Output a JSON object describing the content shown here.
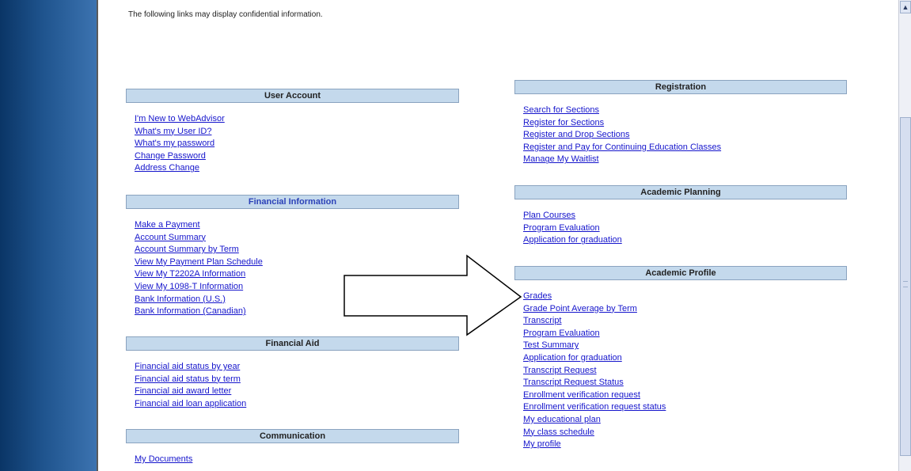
{
  "notice": "The following links may display confidential information.",
  "sections": {
    "user_account": {
      "title": "User Account",
      "links": [
        "I'm New to WebAdvisor",
        "What's my User ID?",
        "What's my password",
        "Change Password",
        "Address Change"
      ]
    },
    "financial_information": {
      "title": "Financial Information",
      "links": [
        "Make a Payment",
        "Account Summary",
        "Account Summary by Term",
        "View My Payment Plan Schedule",
        "View My T2202A Information",
        "View My 1098-T Information",
        "Bank Information (U.S.)",
        "Bank Information (Canadian)"
      ]
    },
    "financial_aid": {
      "title": "Financial Aid",
      "links": [
        "Financial aid status by year",
        "Financial aid status by term",
        "Financial aid award letter",
        "Financial aid loan application"
      ]
    },
    "communication": {
      "title": "Communication",
      "links": [
        "My Documents"
      ]
    },
    "registration": {
      "title": "Registration",
      "links": [
        "Search for Sections",
        "Register for Sections",
        "Register and Drop Sections",
        "Register and Pay for Continuing Education Classes",
        "Manage My Waitlist"
      ]
    },
    "academic_planning": {
      "title": "Academic Planning",
      "links": [
        "Plan Courses",
        "Program Evaluation",
        "Application for graduation"
      ]
    },
    "academic_profile": {
      "title": "Academic Profile",
      "links": [
        "Grades",
        "Grade Point Average by Term",
        "Transcript",
        "Program Evaluation",
        "Test Summary",
        "Application for graduation",
        "Transcript Request",
        "Transcript Request Status",
        "Enrollment verification request",
        "Enrollment verification request status",
        "My educational plan",
        "My class schedule",
        "My profile"
      ]
    }
  },
  "colors": {
    "header_bg": "#c4d9ec",
    "link": "#1515cc",
    "sidebar": "#1f548e"
  },
  "icons": {
    "arrow": "right-arrow-icon",
    "scroll_up": "scroll-up-arrow-icon"
  }
}
